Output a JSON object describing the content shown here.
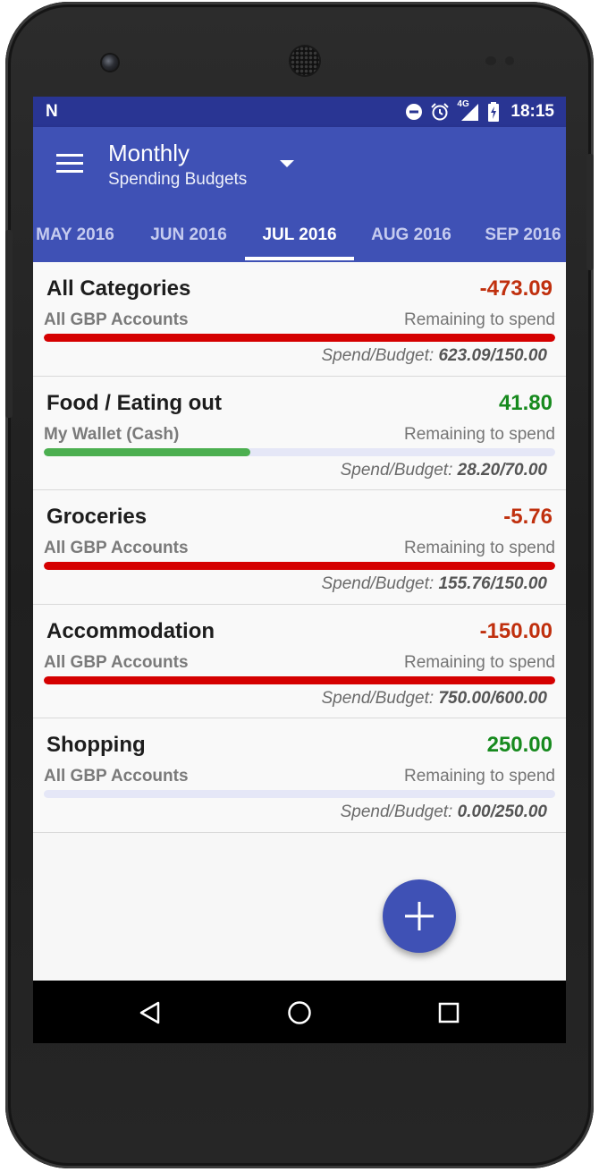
{
  "status_bar": {
    "logo": "N",
    "time": "18:15",
    "network": "4G",
    "icons": [
      "dnd-icon",
      "alarm-icon",
      "signal-icon",
      "battery-charging-icon"
    ]
  },
  "app_bar": {
    "title": "Monthly",
    "subtitle": "Spending Budgets"
  },
  "tabs": [
    {
      "label": "MAY 2016",
      "active": false
    },
    {
      "label": "JUN 2016",
      "active": false
    },
    {
      "label": "JUL 2016",
      "active": true
    },
    {
      "label": "AUG 2016",
      "active": false
    },
    {
      "label": "SEP 2016",
      "active": false
    }
  ],
  "budgets": [
    {
      "name": "All Categories",
      "amount": "-473.09",
      "account": "All GBP Accounts",
      "remaining_label": "Remaining to spend",
      "spend_label": "Spend/Budget:",
      "spend": "623.09",
      "budget": "150.00",
      "progress": 1.0,
      "status": "over"
    },
    {
      "name": "Food / Eating out",
      "amount": "41.80",
      "account": "My Wallet (Cash)",
      "remaining_label": "Remaining to spend",
      "spend_label": "Spend/Budget:",
      "spend": "28.20",
      "budget": "70.00",
      "progress": 0.403,
      "status": "under"
    },
    {
      "name": "Groceries",
      "amount": "-5.76",
      "account": "All GBP Accounts",
      "remaining_label": "Remaining to spend",
      "spend_label": "Spend/Budget:",
      "spend": "155.76",
      "budget": "150.00",
      "progress": 1.0,
      "status": "over"
    },
    {
      "name": "Accommodation",
      "amount": "-150.00",
      "account": "All GBP Accounts",
      "remaining_label": "Remaining to spend",
      "spend_label": "Spend/Budget:",
      "spend": "750.00",
      "budget": "600.00",
      "progress": 1.0,
      "status": "over"
    },
    {
      "name": "Shopping",
      "amount": "250.00",
      "account": "All GBP Accounts",
      "remaining_label": "Remaining to spend",
      "spend_label": "Spend/Budget:",
      "spend": "0.00",
      "budget": "250.00",
      "progress": 0.0,
      "status": "under"
    }
  ],
  "colors": {
    "primary": "#3f51b5",
    "primary_dark": "#293593",
    "negative_amount": "#c0300e",
    "positive_amount": "#178a1e",
    "bar_over": "#d50000",
    "bar_under": "#4caf50",
    "bar_track": "#e5e7f7"
  },
  "fab": {
    "icon": "plus-icon"
  },
  "nav_bar": {
    "icons": [
      "back-icon",
      "home-icon",
      "recents-icon"
    ]
  }
}
